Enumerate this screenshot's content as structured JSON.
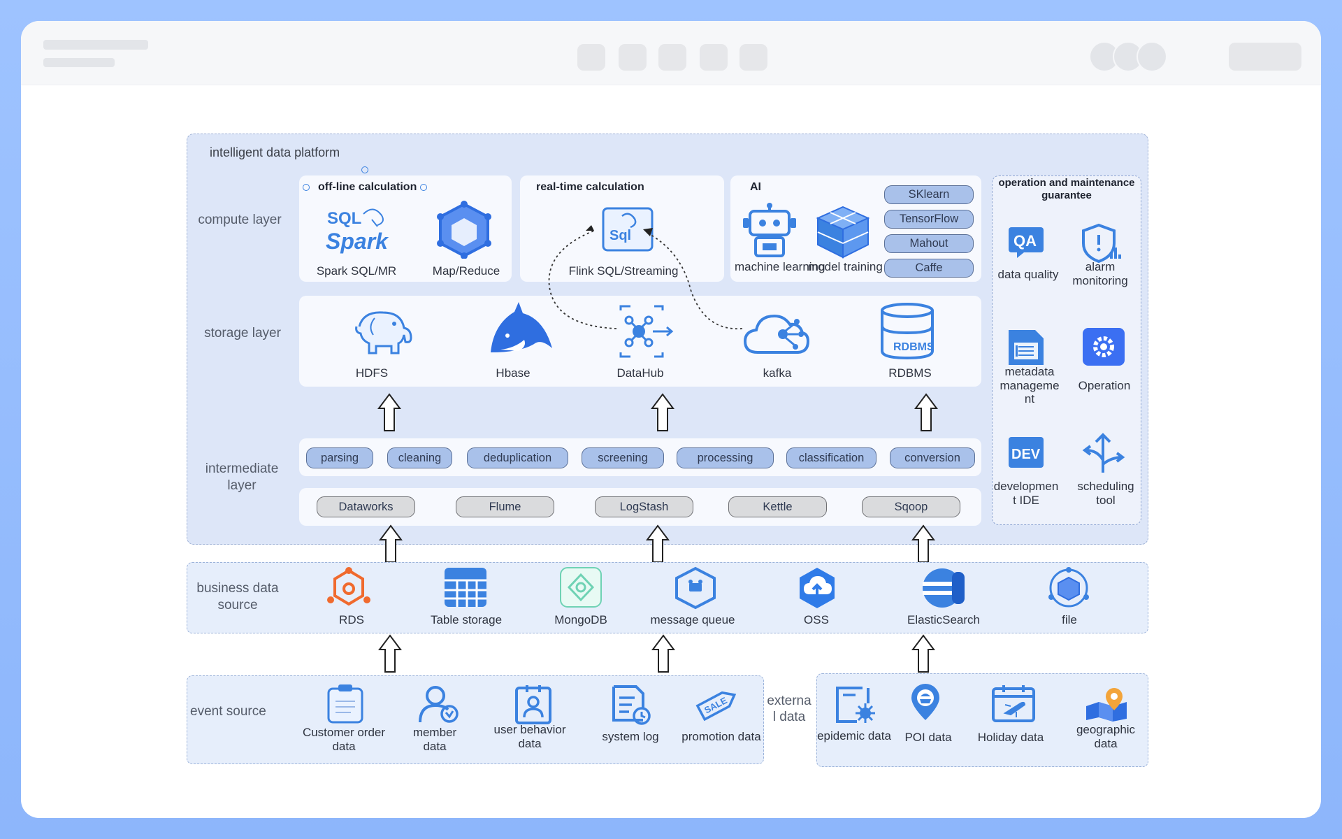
{
  "platform_title": "intelligent data platform",
  "layers": {
    "compute": "compute layer",
    "storage": "storage layer",
    "intermediate": "intermediate layer",
    "business": "business data source",
    "event": "event source",
    "external": "externa l data"
  },
  "compute": {
    "offline": {
      "title": "off-line calculation",
      "items": [
        "Spark SQL/MR",
        "Map/Reduce"
      ]
    },
    "realtime": {
      "title": "real-time calculation",
      "items": [
        "Flink SQL/Streaming"
      ]
    },
    "ai": {
      "title": "AI",
      "items": [
        "machine learning",
        "model training"
      ],
      "tools": [
        "SKlearn",
        "TensorFlow",
        "Mahout",
        "Caffe"
      ]
    }
  },
  "storage": [
    "HDFS",
    "Hbase",
    "DataHub",
    "kafka",
    "RDBMS"
  ],
  "processing": [
    "parsing",
    "cleaning",
    "deduplication",
    "screening",
    "processing",
    "classification",
    "conversion"
  ],
  "ingest_tools": [
    "Dataworks",
    "Flume",
    "LogStash",
    "Kettle",
    "Sqoop"
  ],
  "ops": {
    "title": "operation and maintenance guarantee",
    "items": [
      "data quality",
      "alarm monitoring",
      "metadata manageme nt",
      "Operation",
      "developmen t IDE",
      "scheduling tool"
    ]
  },
  "business_sources": [
    "RDS",
    "Table storage",
    "MongoDB",
    "message queue",
    "OSS",
    "ElasticSearch",
    "file"
  ],
  "event_sources": [
    "Customer order data",
    "member data",
    "user behavior data",
    "system log",
    "promotion data"
  ],
  "external_sources": [
    "epidemic data",
    "POI data",
    "Holiday data",
    "geographic data"
  ],
  "icon_text": {
    "sql": "SQL",
    "spark": "Spark",
    "sqlbox": "Sql",
    "rdbms": "RDBMS",
    "qa": "QA",
    "dev": "DEV",
    "sale": "SALE"
  },
  "icons": [
    "spark-icon",
    "cube-icon",
    "flink-icon",
    "robot-icon",
    "model-cube-icon",
    "hdfs-elephant-icon",
    "hbase-orca-icon",
    "datahub-icon",
    "kafka-cloud-icon",
    "rdbms-cylinder-icon",
    "qa-icon",
    "alarm-shield-icon",
    "metadata-doc-icon",
    "gear-icon",
    "dev-icon",
    "scheduling-arrows-icon",
    "rds-icon",
    "table-storage-icon",
    "mongodb-icon",
    "message-queue-icon",
    "oss-icon",
    "elasticsearch-icon",
    "file-icon",
    "order-clipboard-icon",
    "member-icon",
    "user-behavior-icon",
    "system-log-icon",
    "sale-tag-icon",
    "epidemic-icon",
    "poi-icon",
    "holiday-calendar-icon",
    "geographic-map-icon"
  ],
  "colors": {
    "accent": "#3b82e0",
    "panel": "#dde6f8",
    "pill_blue": "#a9c1ea",
    "pill_grey": "#dadbdd",
    "rds_orange": "#f06a2e",
    "mongo_green": "#6fd2b4"
  }
}
